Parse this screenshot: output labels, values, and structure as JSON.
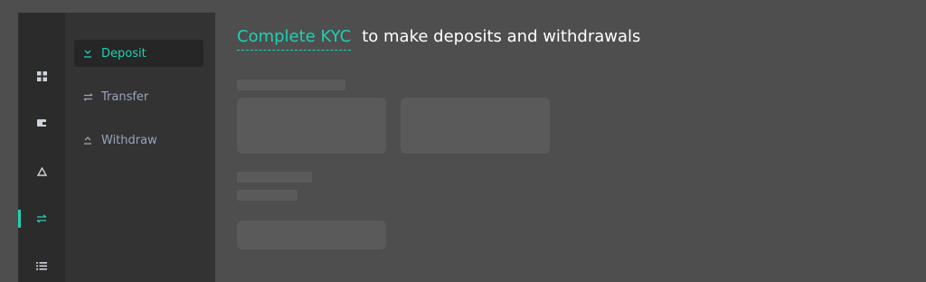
{
  "rail": {
    "items": [
      {
        "icon": "dashboard-grid-icon"
      },
      {
        "icon": "wallet-icon"
      },
      {
        "icon": "recycle-icon"
      },
      {
        "icon": "transfer-arrows-icon",
        "active": true
      },
      {
        "icon": "list-icon"
      }
    ],
    "accent": "#1fd1b2"
  },
  "subnav": {
    "items": [
      {
        "label": "Deposit",
        "icon": "download-icon",
        "active": true
      },
      {
        "label": "Transfer",
        "icon": "exchange-icon"
      },
      {
        "label": "Withdraw",
        "icon": "upload-icon"
      }
    ]
  },
  "banner": {
    "link": "Complete KYC",
    "text": "to make deposits and withdrawals"
  },
  "colors": {
    "background": "#4e4e4e",
    "rail": "#2b2b2b",
    "subnav": "#333333",
    "accent": "#1fd1b2"
  }
}
